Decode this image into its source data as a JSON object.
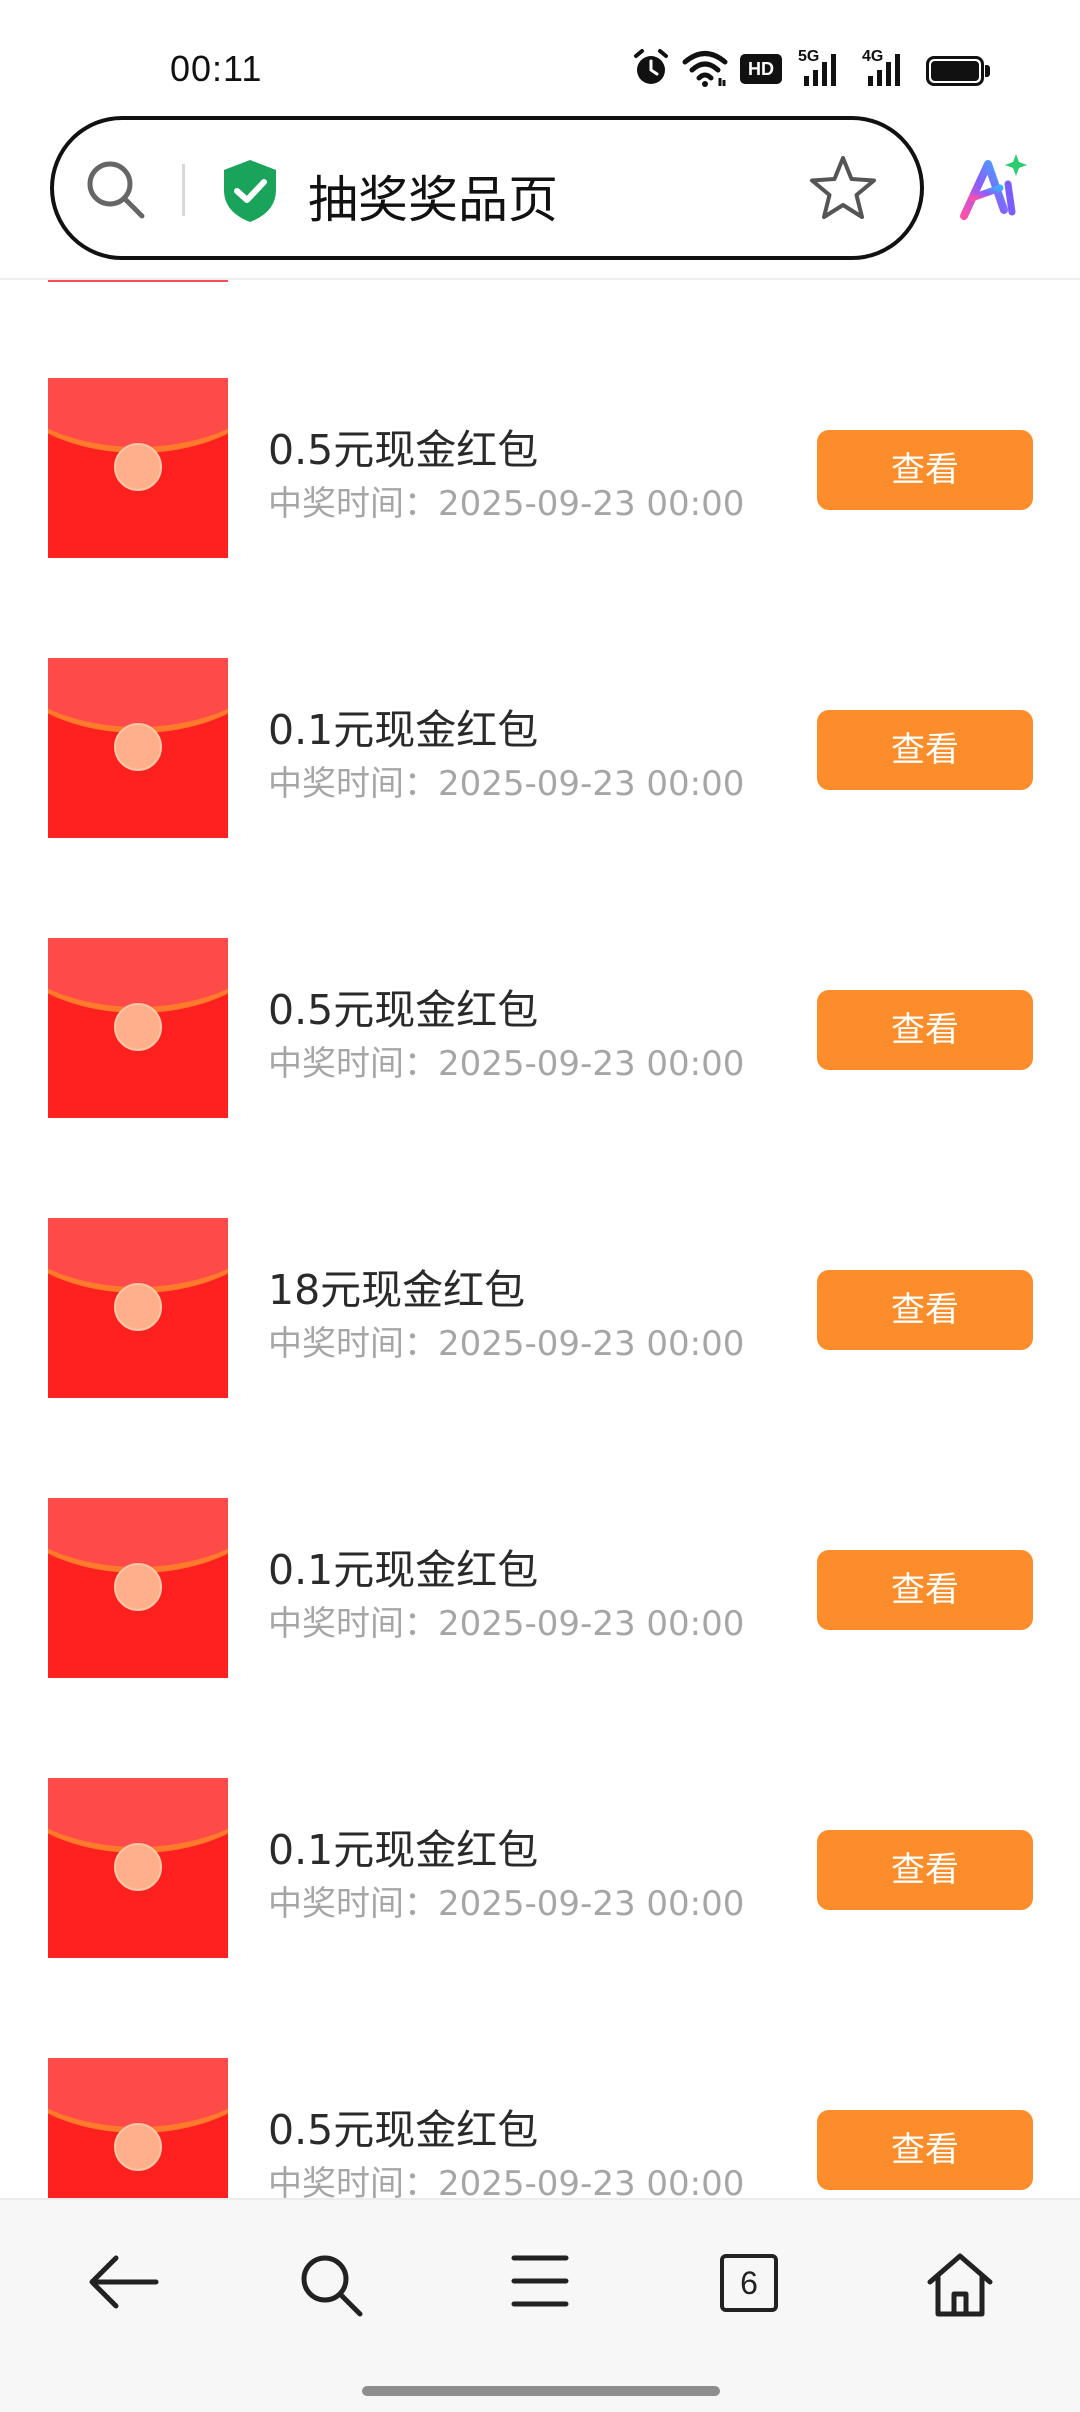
{
  "status_bar": {
    "time": "00:11",
    "icons": [
      "alarm-icon",
      "wifi-icon",
      "hd-icon",
      "5g-signal-icon",
      "4g-signal-icon",
      "battery-icon"
    ],
    "hd_label": "HD",
    "net1_label": "5G",
    "net2_label": "4G"
  },
  "address_bar": {
    "title": "抽奖奖品页",
    "security": "shield-check-icon"
  },
  "colors": {
    "accent": "#fd8d2a",
    "shield": "#1aa35a",
    "red_packet": "#ff2020"
  },
  "prizes": [
    {
      "name": "0.5元现金红包",
      "time": "中奖时间：2025-09-23 00:00",
      "action": "查看"
    },
    {
      "name": "0.1元现金红包",
      "time": "中奖时间：2025-09-23 00:00",
      "action": "查看"
    },
    {
      "name": "0.5元现金红包",
      "time": "中奖时间：2025-09-23 00:00",
      "action": "查看"
    },
    {
      "name": "18元现金红包",
      "time": "中奖时间：2025-09-23 00:00",
      "action": "查看"
    },
    {
      "name": "0.1元现金红包",
      "time": "中奖时间：2025-09-23 00:00",
      "action": "查看"
    },
    {
      "name": "0.1元现金红包",
      "time": "中奖时间：2025-09-23 00:00",
      "action": "查看"
    },
    {
      "name": "0.5元现金红包",
      "time": "中奖时间：2025-09-23 00:00",
      "action": "查看"
    }
  ],
  "bottom_nav": {
    "items": [
      "back-arrow-icon",
      "search-icon",
      "menu-icon",
      "tabs-icon",
      "home-icon"
    ],
    "tab_count": "6"
  }
}
